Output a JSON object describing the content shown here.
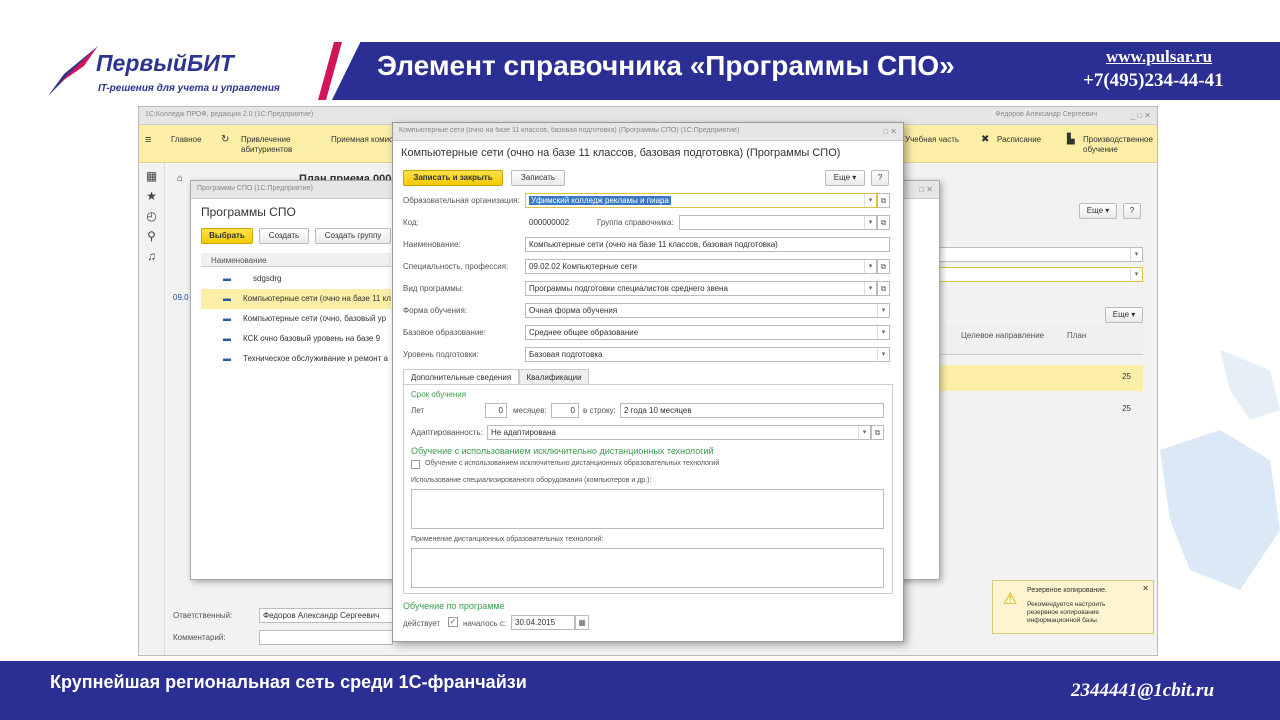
{
  "header": {
    "logo": "ПервыйБИТ",
    "logo_sub": "IT-решения для учета и управления",
    "title": "Элемент справочника «Программы СПО»",
    "url": "www.pulsar.ru",
    "phone": "+7(495)234-44-41"
  },
  "footer": {
    "slogan": "Крупнейшая региональная сеть среди 1С-франчайзи",
    "email": "2344441@1cbit.ru"
  },
  "main_window": {
    "title": "1С:Колледж ПРОФ, редакция 2.0 (1С:Предприятие)",
    "user": "Федоров Александр Сергеевич",
    "sections": [
      "Главное",
      "Привлечение абитуриентов",
      "Приемная комиссия",
      "Учебная часть",
      "Расписание",
      "Производственное обучение"
    ],
    "doc_title": "План приема 0000(",
    "more_label": "Еще",
    "question": "?",
    "columns": [
      "Целевое направление",
      "План"
    ],
    "plan_values": [
      "25",
      "25"
    ],
    "code_value": "09.0",
    "responsible_label": "Ответственный:",
    "responsible_value": "Федоров Александр Сергеевич",
    "comment_label": "Комментарий:"
  },
  "programs_window": {
    "title": "Программы СПО (1С:Предприятие)",
    "heading": "Программы СПО",
    "btn_select": "Выбрать",
    "btn_create": "Создать",
    "btn_group": "Создать группу",
    "col_name": "Наименование",
    "rows": [
      "sdgsdrg",
      "Компьютерные сети (очно на базе 11 кл",
      "Компьютерные сети (очно, базовый ур",
      "КСК очно базовый уровень на базе 9",
      "Техническое обслуживание и ремонт а"
    ]
  },
  "dialog": {
    "window_title": "Компьютерные сети (очно на базе 11 классов, базовая подготовка) (Программы СПО) (1С:Предприятие)",
    "heading": "Компьютерные сети (очно на базе 11 классов, базовая подготовка) (Программы СПО)",
    "btn_save_close": "Записать и закрыть",
    "btn_save": "Записать",
    "more": "Еще",
    "help": "?",
    "fields": {
      "org_label": "Образовательная организация:",
      "org_value": "Уфимский колледж рекламы и пиара",
      "code_label": "Код:",
      "code_value": "000000002",
      "group_label": "Группа справочника:",
      "name_label": "Наименование:",
      "name_value": "Компьютерные сети (очно на базе 11 классов, базовая подготовка)",
      "spec_label": "Специальность, профессия:",
      "spec_value": "09.02.02   Компьютерные сети",
      "type_label": "Вид программы:",
      "type_value": "Программы подготовки специалистов среднего звена",
      "form_label": "Форма обучения:",
      "form_value": "Очная форма обучения",
      "base_label": "Базовое образование:",
      "base_value": "Среднее общее образование",
      "level_label": "Уровень подготовки:",
      "level_value": "Базовая подготовка"
    },
    "tabs": [
      "Дополнительные сведения",
      "Квалификации"
    ],
    "duration": {
      "title": "Срок обучения",
      "years_label": "Лет",
      "years": "0",
      "months_label": "месяцев:",
      "months": "0",
      "string_label": "в строку:",
      "string_value": "2 года 10 месяцев"
    },
    "adapt_label": "Адаптированность:",
    "adapt_value": "Не адаптирована",
    "distance_title": "Обучение с использованием исключительно дистанционных технологий",
    "distance_check": "Обучение с использованием исключительно дистанционных образовательных технологий",
    "equipment_label": "Использование специализированного оборудования (компьютеров и др.):",
    "distance_tech_label": "Применение дистанционных образовательных технологий:",
    "program_title": "Обучение по программе",
    "active_label": "действует",
    "started_label": "началось с:",
    "start_date": "30.04.2015"
  },
  "notification": {
    "title": "Резервное копирование.",
    "text": "Рекомендуется настроить резервное копирование информационной базы."
  },
  "colors": {
    "brand_blue": "#2b2e93",
    "accent_yellow": "#fbeea7",
    "green": "#3c9a4e"
  }
}
